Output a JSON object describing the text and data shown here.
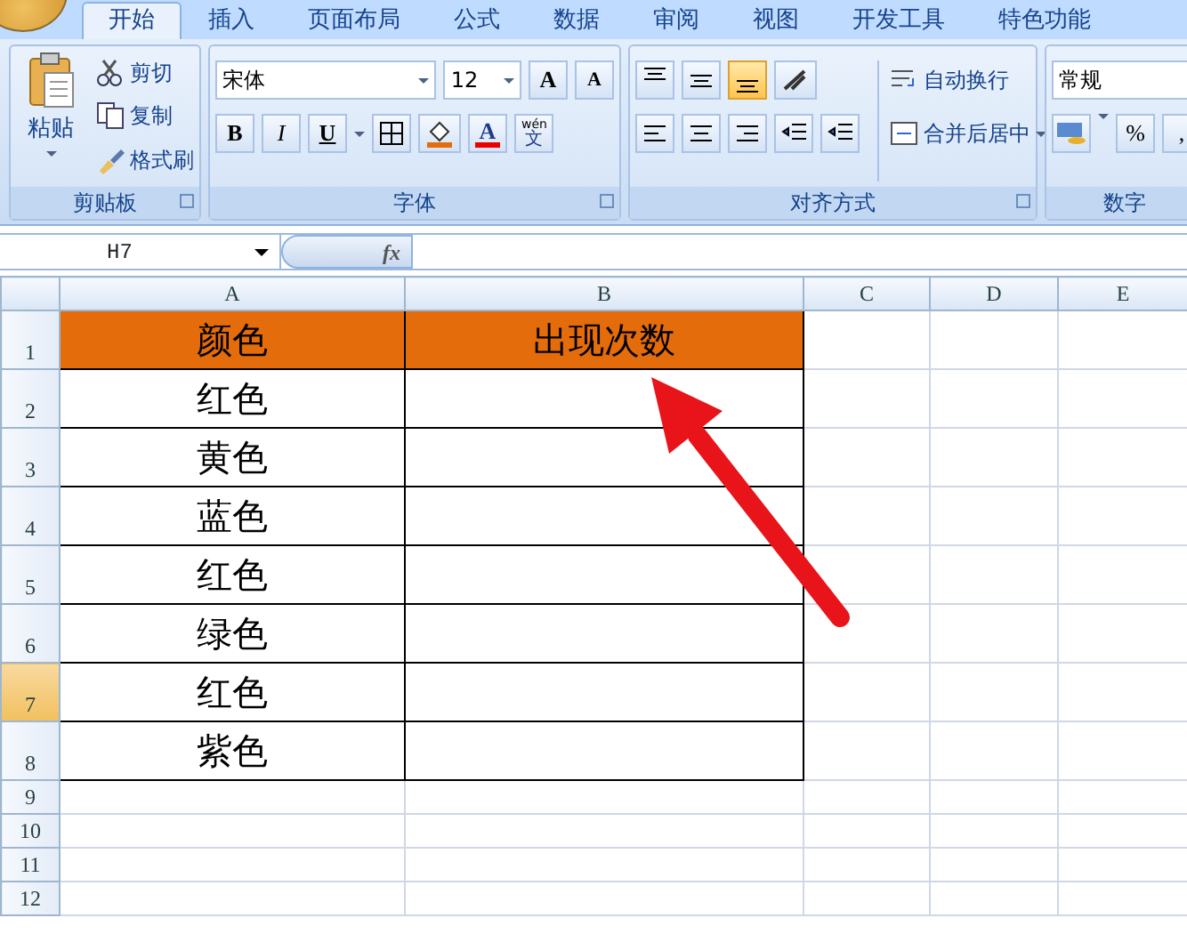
{
  "tabs": [
    {
      "label": "开始",
      "selected": true
    },
    {
      "label": "插入",
      "selected": false
    },
    {
      "label": "页面布局",
      "selected": false
    },
    {
      "label": "公式",
      "selected": false
    },
    {
      "label": "数据",
      "selected": false
    },
    {
      "label": "审阅",
      "selected": false
    },
    {
      "label": "视图",
      "selected": false
    },
    {
      "label": "开发工具",
      "selected": false
    },
    {
      "label": "特色功能",
      "selected": false
    }
  ],
  "clipboard": {
    "paste": "粘贴",
    "items": [
      "剪切",
      "复制",
      "格式刷"
    ],
    "title": "剪贴板"
  },
  "font": {
    "name": "宋体",
    "size": "12",
    "grow": "A",
    "shrink": "A",
    "styles": [
      "B",
      "I",
      "U"
    ],
    "font_color": "A",
    "phonetic_ruby": "wén",
    "phonetic_base": "文",
    "title": "字体"
  },
  "alignment": {
    "vertical": [
      {
        "selected": false
      },
      {
        "selected": false
      },
      {
        "selected": true
      }
    ],
    "wrap": "自动换行",
    "merge": "合并后居中",
    "title": "对齐方式"
  },
  "number": {
    "format": "常规",
    "percent": "%",
    "comma": ",",
    "title": "数字"
  },
  "formula_bar": {
    "name_box": "H7",
    "function_label": "fx"
  },
  "sheet": {
    "columns": [
      "A",
      "B",
      "C",
      "D",
      "E"
    ],
    "rows": [
      {
        "header": "1",
        "selected": false,
        "kind": "header",
        "cells": [
          "颜色",
          "出现次数"
        ]
      },
      {
        "header": "2",
        "selected": false,
        "kind": "data",
        "cells": [
          "红色"
        ]
      },
      {
        "header": "3",
        "selected": false,
        "kind": "data",
        "cells": [
          "黄色"
        ]
      },
      {
        "header": "4",
        "selected": false,
        "kind": "data",
        "cells": [
          "蓝色"
        ]
      },
      {
        "header": "5",
        "selected": false,
        "kind": "data",
        "cells": [
          "红色"
        ]
      },
      {
        "header": "6",
        "selected": false,
        "kind": "data",
        "cells": [
          "绿色"
        ]
      },
      {
        "header": "7",
        "selected": true,
        "kind": "data",
        "cells": [
          "红色"
        ]
      },
      {
        "header": "8",
        "selected": false,
        "kind": "data",
        "cells": [
          "紫色"
        ]
      },
      {
        "header": "9",
        "selected": false,
        "kind": "empty"
      },
      {
        "header": "10",
        "selected": false,
        "kind": "empty"
      },
      {
        "header": "11",
        "selected": false,
        "kind": "empty"
      },
      {
        "header": "12",
        "selected": false,
        "kind": "empty"
      }
    ]
  }
}
